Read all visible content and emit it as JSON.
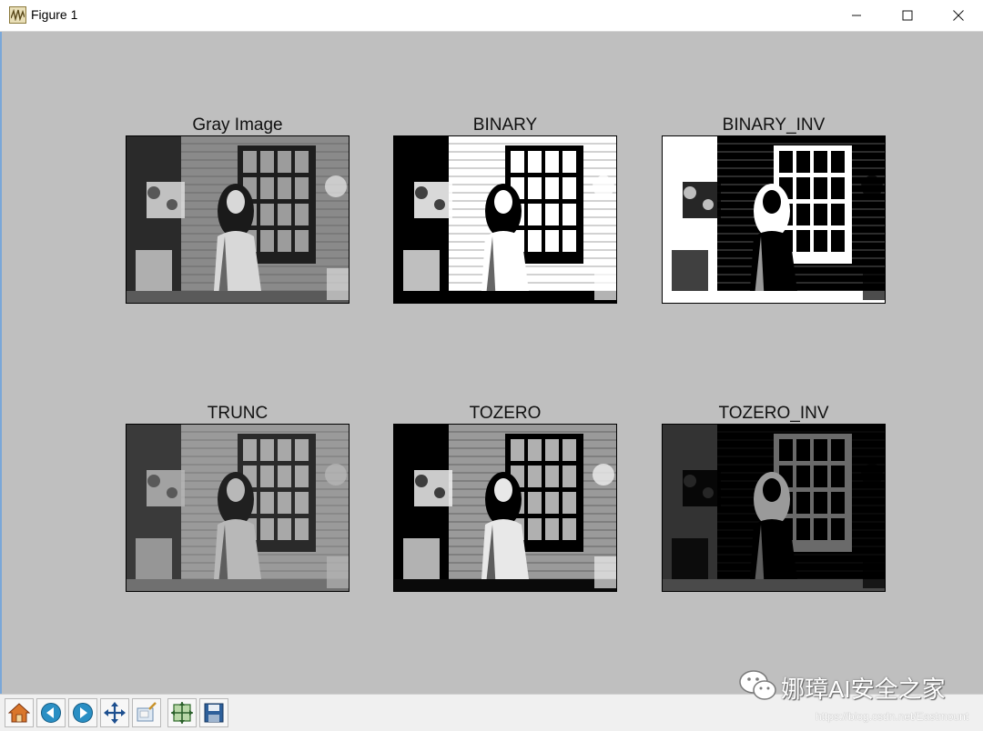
{
  "window": {
    "title": "Figure 1",
    "controls": [
      "minimize",
      "maximize",
      "close"
    ]
  },
  "subplots": [
    {
      "title": "Gray Image",
      "variant": "gray"
    },
    {
      "title": "BINARY",
      "variant": "binary"
    },
    {
      "title": "BINARY_INV",
      "variant": "binary_inv"
    },
    {
      "title": "TRUNC",
      "variant": "trunc"
    },
    {
      "title": "TOZERO",
      "variant": "tozero"
    },
    {
      "title": "TOZERO_INV",
      "variant": "tozero_inv"
    }
  ],
  "toolbar": {
    "buttons": [
      {
        "name": "home",
        "icon": "home-icon"
      },
      {
        "name": "back",
        "icon": "back-arrow-icon"
      },
      {
        "name": "forward",
        "icon": "forward-arrow-icon"
      },
      {
        "name": "pan",
        "icon": "move-cross-icon"
      },
      {
        "name": "zoom",
        "icon": "zoom-rect-icon"
      },
      {
        "name": "subplots",
        "icon": "configure-subplots-icon"
      },
      {
        "name": "save",
        "icon": "save-icon"
      }
    ]
  },
  "watermark": {
    "brand": "娜璋AI安全之家",
    "url": "https://blog.csdn.net/Eastmount"
  },
  "colors": {
    "canvas": "#bfbfbf",
    "toolbar": "#f0f0f0",
    "titlebar": "#ffffff"
  }
}
